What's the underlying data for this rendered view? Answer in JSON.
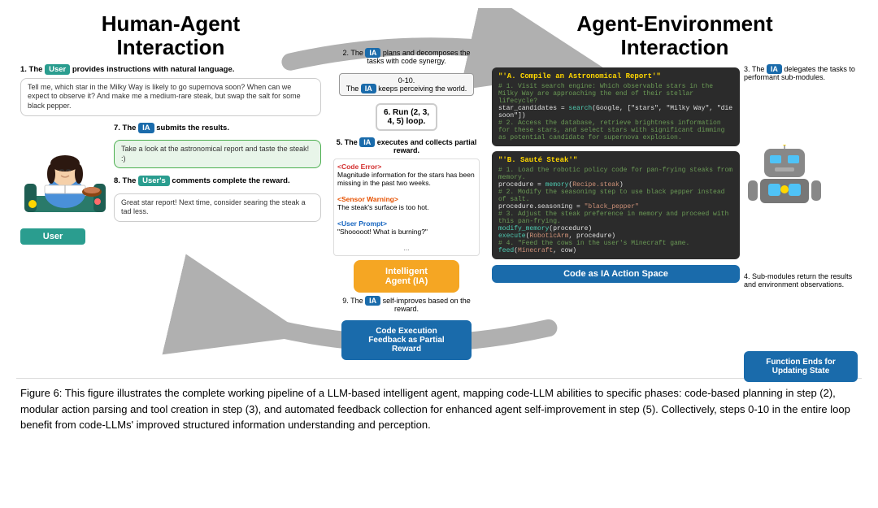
{
  "diagram": {
    "left_title": "Human-Agent\nInteraction",
    "right_title": "Agent-Environment\nInteraction",
    "steps": {
      "step1": "1. The User provides instructions with natural language.",
      "step2": "2. The IA plans and decomposes the tasks with code synergy.",
      "step3": "3. The IA delegates the tasks to performant sub-modules.",
      "step4": "4. Sub-modules return the results and environment observations.",
      "step5": "5. The IA executes and collects partial reward.",
      "step6": "6. Run (2, 3, 4, 5) loop.",
      "step7": "7. The IA submits the results.",
      "step8": "8. The User's comments complete the reward.",
      "step9": "9. The IA self-improves based on the reward.",
      "counter": "0-10. The IA keeps perceiving the world."
    },
    "chat_messages": {
      "user_query": "Tell me, which star in the Milky Way is likely to go supernova soon? When can we expect to observe it? And make me a medium-rare steak, but swap the salt for some black pepper.",
      "ia_report": "Take a look at the astronomical report and taste the steak! :)",
      "user_comment": "Great star report! Next time, consider searing the steak a tad less."
    },
    "error_messages": {
      "code_error": "<Code Error> Magnitude information for the stars has been missing in the past two weeks.",
      "sensor_warning": "<Sensor Warning> The steak's surface is too hot.",
      "user_prompt": "<User Prompt> \"Shooooot! What is burning?\""
    },
    "code_panel_a": {
      "title": "\"'A. Compile an Astronomical Report'\"",
      "lines": [
        "# 1. Visit search engine: Which observable stars in the Milky Way are approaching the end of their stellar lifecycle?",
        "star_candidates = search(Google, [\"stars\", \"Milky Way\", \"die soon\"])",
        "# 2. Access the database, retrieve brightness information for these stars, and select stars with significant dimming as potential candidate for supernova explosion."
      ]
    },
    "code_panel_b": {
      "title": "\"'B. Sauté Steak'\"",
      "lines": [
        "# 1. Load the robotic policy code for pan-frying steaks from memory.",
        "procedure = memory(Recipe.steak)",
        "# 2. Modify the seasoning step to use black pepper instead of salt.",
        "procedure.seasoning = \"black_pepper\"",
        "# 3. Adjust the steak preference in memory and proceed with this pan-frying.",
        "modify_memory(procedure)",
        "execute(RoboticArm, procedure)",
        "# 4. \"Feed the cows in the user's Minecraft game.",
        "feed(Minecraft, cow)"
      ]
    },
    "boxes": {
      "agent": "Intelligent\nAgent (IA)",
      "code_action": "Code as IA Action Space",
      "partial_reward": "Code Execution\nFeedback as Partial\nReward",
      "function_ends": "Function Ends for\nUpdating State"
    },
    "badges": {
      "user": "User",
      "ia": "IA"
    }
  },
  "caption": {
    "figure_label": "Figure 6:",
    "text": "This figure illustrates the complete working pipeline of a LLM-based intelligent agent, mapping code-LLM abilities to specific phases: code-based planning in step (2), modular action parsing and tool creation in step (3), and automated feedback collection for enhanced agent self-improvement in step (5). Collectively, steps 0-10 in the entire loop benefit from code-LLMs' improved structured information understanding and perception."
  }
}
